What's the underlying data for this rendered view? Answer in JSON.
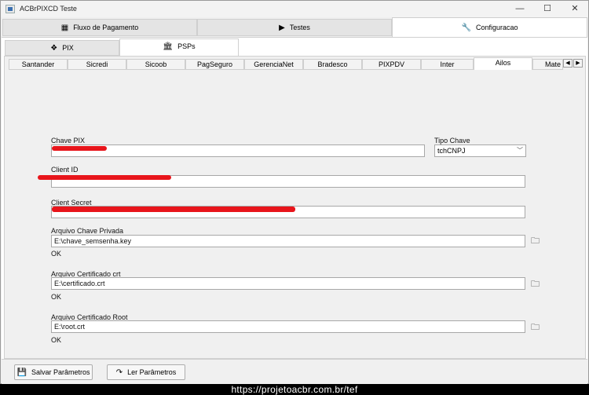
{
  "window": {
    "title": "ACBrPIXCD Teste",
    "controls": {
      "minimize": "—",
      "maximize": "☐",
      "close": "✕"
    }
  },
  "top_tabs": [
    {
      "label": "Fluxo de Pagamento",
      "icon": "qr-code-icon"
    },
    {
      "label": "Testes",
      "icon": "play-icon"
    },
    {
      "label": "Configuracao",
      "icon": "wrench-icon"
    }
  ],
  "sub_tabs": [
    {
      "label": "PIX",
      "icon": "pix-icon"
    },
    {
      "label": "PSPs",
      "icon": "bank-icon"
    }
  ],
  "bank_tabs": [
    "Santander",
    "Sicredi",
    "Sicoob",
    "PagSeguro",
    "GerenciaNet",
    "Bradesco",
    "PIXPDV",
    "Inter",
    "Ailos",
    "Mate"
  ],
  "active_bank": "Ailos",
  "form": {
    "chave_pix_label": "Chave PIX",
    "chave_pix_value": "",
    "tipo_chave_label": "Tipo Chave",
    "tipo_chave_value": "tchCNPJ",
    "client_id_label": "Client ID",
    "client_id_value": "",
    "client_secret_label": "Client Secret",
    "client_secret_value": "",
    "arquivo_chave_label": "Arquivo Chave Privada",
    "arquivo_chave_value": "E:\\chave_semsenha.key",
    "arquivo_chave_status": "OK",
    "arquivo_cert_label": "Arquivo Certificado crt",
    "arquivo_cert_value": "E:\\certificado.crt",
    "arquivo_cert_status": "OK",
    "arquivo_root_label": "Arquivo Certificado Root",
    "arquivo_root_value": "E:\\root.crt",
    "arquivo_root_status": "OK"
  },
  "footer": {
    "salvar_label": "Salvar Parâmetros",
    "ler_label": "Ler Parâmetros"
  },
  "watermark": "https://projetoacbr.com.br/tef",
  "colors": {
    "redaction": "#e8151b"
  }
}
